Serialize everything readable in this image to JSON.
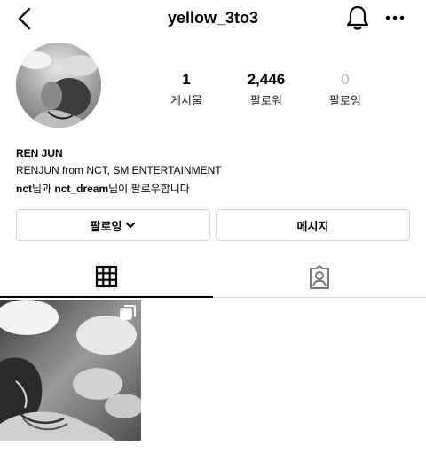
{
  "header": {
    "username": "yellow_3to3"
  },
  "icons": {
    "back": "chevron-left-icon",
    "bell": "bell-icon",
    "more": "more-horizontal-icon",
    "grid": "grid-icon",
    "tagged": "tagged-person-icon",
    "multi": "multiple-posts-icon",
    "follow_chevron": "chevron-down-icon"
  },
  "stats": [
    {
      "value": "1",
      "label": "게시물"
    },
    {
      "value": "2,446",
      "label": "팔로워"
    },
    {
      "value": "0",
      "label": "팔로잉"
    }
  ],
  "bio": {
    "name": "REN JUN",
    "description": "RENJUN from NCT, SM ENTERTAINMENT",
    "followed_by": {
      "user1": "nct",
      "conn1": "님과 ",
      "user2": "nct_dream",
      "conn2": "님이 팔로우합니다"
    }
  },
  "actions": {
    "follow_label": "팔로잉",
    "message_label": "메시지"
  },
  "colors": {
    "muted": "#b5b5b5",
    "border": "#d6d6d6",
    "text": "#000000"
  }
}
